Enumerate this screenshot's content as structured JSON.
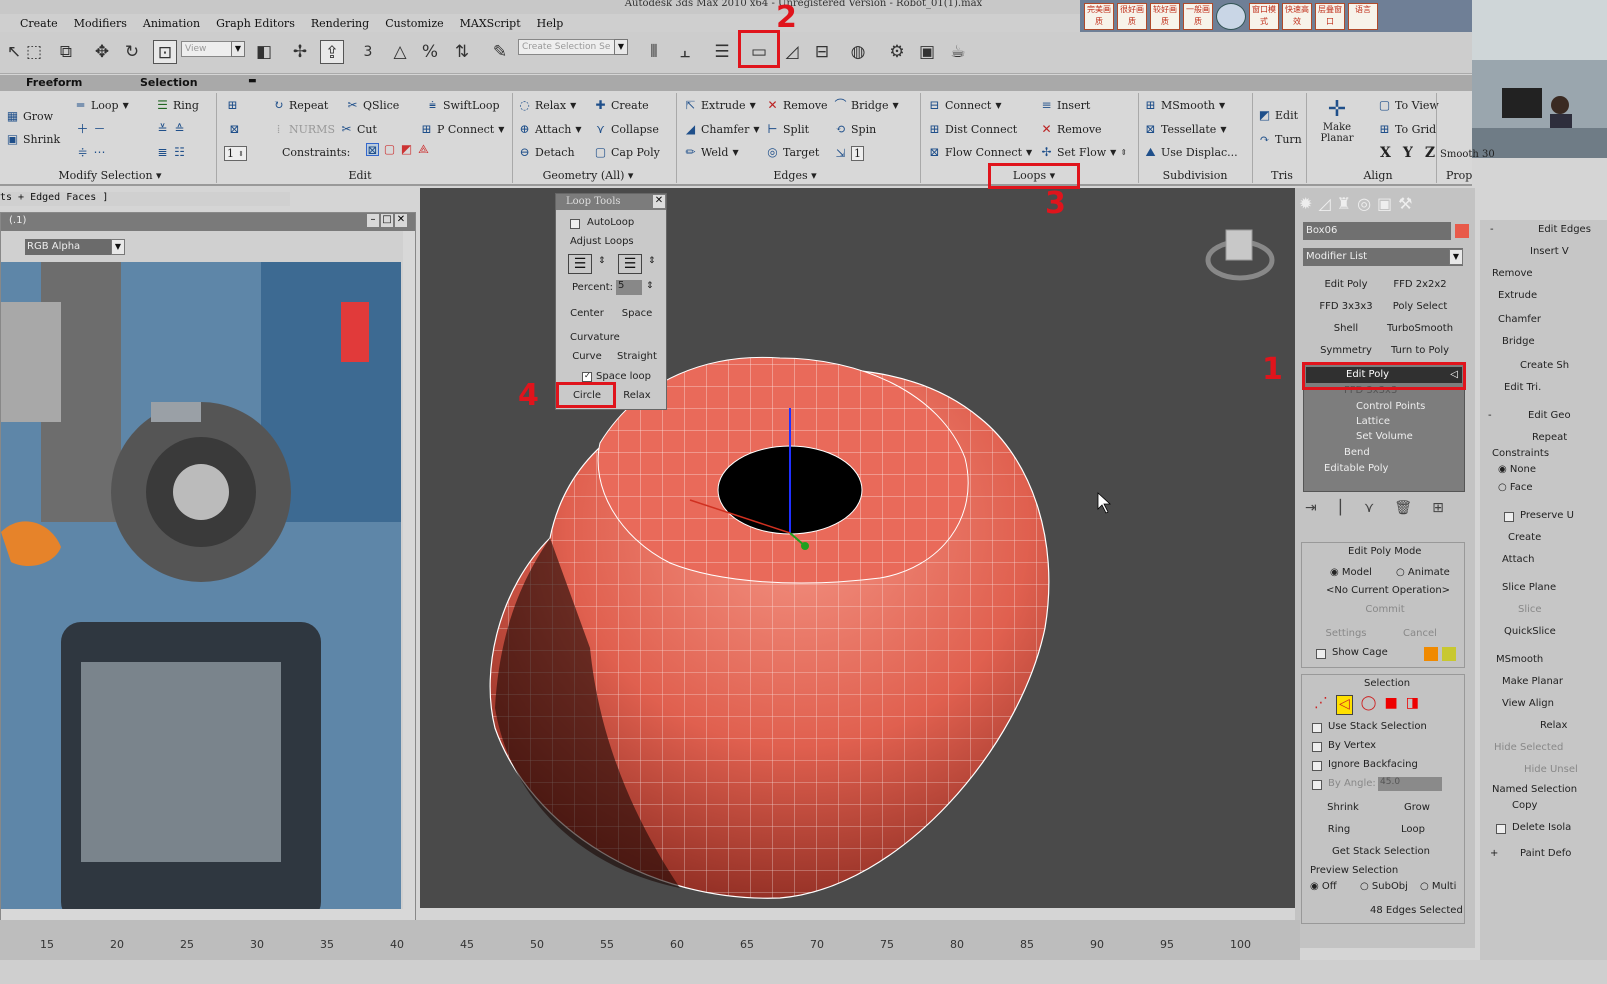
{
  "titlebar": {
    "text": "Autodesk 3ds Max 2010 x64 - Unregistered Version - Robot_01(1).max"
  },
  "menu": [
    "Create",
    "Modifiers",
    "Animation",
    "Graph Editors",
    "Rendering",
    "Customize",
    "MAXScript",
    "Help"
  ],
  "cjk_buttons": [
    "完美画质",
    "很好画质",
    "较好画质",
    "一般画质",
    "",
    "窗口模式",
    "快速高效",
    "层叠窗口",
    "语言"
  ],
  "toolbar": {
    "view_dropdown": "View",
    "selection_set_placeholder": "Create Selection Se",
    "spinner_value": "3"
  },
  "ribbon_tabs": {
    "freeform": "Freeform",
    "selection": "Selection"
  },
  "ribbon": {
    "modify_selection": {
      "grow": "Grow",
      "shrink": "Shrink",
      "loop": "Loop",
      "ring": "Ring",
      "label": "Modify Selection"
    },
    "edit": {
      "repeat": "Repeat",
      "qslice": "QSlice",
      "swiftloop": "SwiftLoop",
      "nurms": "NURMS",
      "cut": "Cut",
      "pconnect": "P Connect",
      "constraints": "Constraints:",
      "label": "Edit",
      "spinner": "1"
    },
    "geometry": {
      "relax": "Relax",
      "create": "Create",
      "attach": "Attach",
      "collapse": "Collapse",
      "detach": "Detach",
      "cap_poly": "Cap Poly",
      "label": "Geometry (All)"
    },
    "edges": {
      "extrude": "Extrude",
      "remove": "Remove",
      "bridge": "Bridge",
      "chamfer": "Chamfer",
      "split": "Split",
      "spin": "Spin",
      "weld": "Weld",
      "target": "Target",
      "label": "Edges",
      "spinner": "1"
    },
    "loops": {
      "connect": "Connect",
      "insert": "Insert",
      "dist_connect": "Dist Connect",
      "remove": "Remove",
      "flow_connect": "Flow Connect",
      "set_flow": "Set Flow",
      "label": "Loops"
    },
    "subdivision": {
      "msmooth": "MSmooth",
      "tessellate": "Tessellate",
      "use_displac": "Use Displac...",
      "label": "Subdivision"
    },
    "tris": {
      "edit": "Edit",
      "turn": "Turn",
      "label": "Tris"
    },
    "align": {
      "make_planar": "Make Planar",
      "to_view": "To View",
      "to_grid": "To Grid",
      "x": "X",
      "y": "Y",
      "z": "Z",
      "label": "Align"
    },
    "properties": {
      "smooth_30": "Smooth 30",
      "label": "Properties"
    }
  },
  "breadcrumb": "ts + Edged Faces ]",
  "refwin": {
    "title": "(.1)",
    "channel": "RGB Alpha"
  },
  "looptools": {
    "title": "Loop Tools",
    "autoloop": "AutoLoop",
    "adjust_loops": "Adjust Loops",
    "percent_label": "Percent:",
    "percent_value": "5",
    "center": "Center",
    "space": "Space",
    "curvature": "Curvature",
    "curve": "Curve",
    "straight": "Straight",
    "space_loop": "Space loop",
    "circle": "Circle",
    "relax": "Relax"
  },
  "cmdpanel": {
    "object_name": "Box06",
    "modifier_list": "Modifier List",
    "mod_buttons": [
      "Edit Poly",
      "FFD 2x2x2",
      "FFD 3x3x3",
      "Poly Select",
      "Shell",
      "TurboSmooth",
      "Symmetry",
      "Turn to Poly"
    ],
    "stack": [
      "Edit Poly",
      "FFD 3x3x3",
      "Control Points",
      "Lattice",
      "Set Volume",
      "Bend",
      "Editable Poly"
    ],
    "edit_poly_mode": {
      "title": "Edit Poly Mode",
      "model": "Model",
      "animate": "Animate",
      "op": "<No Current Operation>",
      "commit": "Commit",
      "settings": "Settings",
      "cancel": "Cancel",
      "show_cage": "Show Cage"
    },
    "selection": {
      "title": "Selection",
      "use_stack": "Use Stack Selection",
      "by_vertex": "By Vertex",
      "ignore_backfacing": "Ignore Backfacing",
      "by_angle": "By Angle:",
      "angle_value": "45.0",
      "shrink": "Shrink",
      "grow": "Grow",
      "ring": "Ring",
      "loop": "Loop",
      "get_stack": "Get Stack Selection",
      "preview": "Preview Selection",
      "off": "Off",
      "subobj": "SubObj",
      "multi": "Multi",
      "status": "48 Edges Selected"
    }
  },
  "farpanel": {
    "title": "Edit Edges",
    "insert": "Insert V",
    "remove": "Remove",
    "extrude": "Extrude",
    "chamfer": "Chamfer",
    "bridge": "Bridge",
    "create_shape": "Create Sh",
    "edit_tri": "Edit Tri.",
    "edit_geo": "Edit Geo",
    "repeat": "Repeat",
    "constraints": "Constraints",
    "none": "None",
    "face": "Face",
    "preserve": "Preserve U",
    "create": "Create",
    "attach": "Attach",
    "slice_plane": "Slice Plane",
    "slice": "Slice",
    "quickslice": "QuickSlice",
    "msmooth": "MSmooth",
    "make_planar": "Make Planar",
    "view_align": "View Align",
    "relax": "Relax",
    "hide_selected": "Hide Selected",
    "hide_unsel": "Hide Unsel",
    "named_sel": "Named Selection",
    "copy": "Copy",
    "delete_isolated": "Delete Isola",
    "paint_deform": "Paint Defo"
  },
  "timeline": [
    15,
    20,
    25,
    30,
    35,
    40,
    45,
    50,
    55,
    60,
    65,
    70,
    75,
    80,
    85,
    90,
    95,
    100
  ],
  "annotations": [
    "1",
    "2",
    "3",
    "4"
  ],
  "colors": {
    "accent_red": "#e0141c",
    "mesh_face": "#e9695a",
    "viewport_bg": "#4a4a4a"
  }
}
